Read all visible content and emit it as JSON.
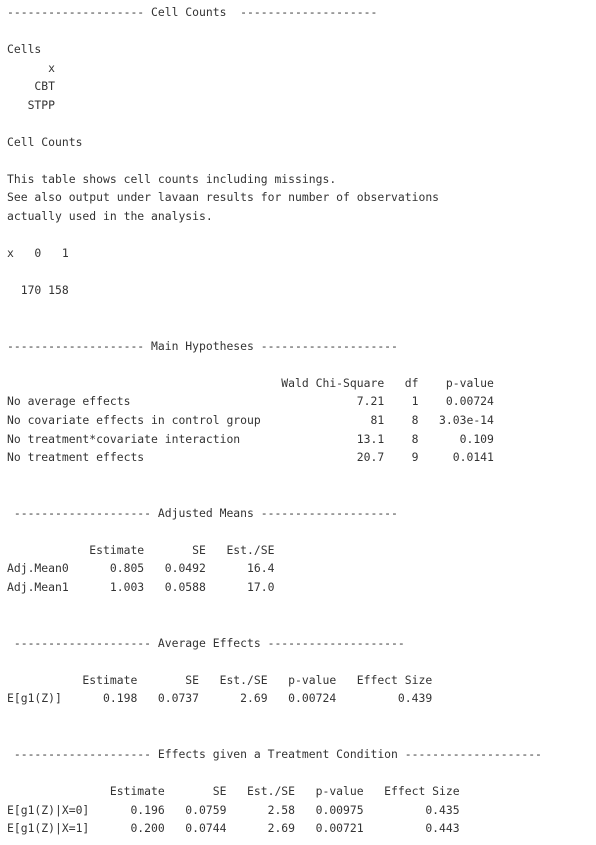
{
  "lines": [
    "-------------------- Cell Counts  --------------------",
    "",
    "Cells",
    "      x",
    "    CBT",
    "   STPP",
    "",
    "Cell Counts",
    "",
    "This table shows cell counts including missings.",
    "See also output under lavaan results for number of observations",
    "actually used in the analysis.",
    "",
    "x   0   1",
    "",
    "  170 158",
    "",
    "",
    "-------------------- Main Hypotheses --------------------",
    "",
    "                                        Wald Chi-Square   df    p-value",
    "No average effects                                 7.21    1    0.00724",
    "No covariate effects in control group                81    8   3.03e-14",
    "No treatment*covariate interaction                 13.1    8      0.109",
    "No treatment effects                               20.7    9     0.0141",
    "",
    "",
    " -------------------- Adjusted Means --------------------",
    "",
    "            Estimate       SE   Est./SE",
    "Adj.Mean0      0.805   0.0492      16.4",
    "Adj.Mean1      1.003   0.0588      17.0",
    "",
    "",
    " -------------------- Average Effects --------------------",
    "",
    "           Estimate       SE   Est./SE   p-value   Effect Size",
    "E[g1(Z)]      0.198   0.0737      2.69   0.00724         0.439",
    "",
    "",
    " -------------------- Effects given a Treatment Condition --------------------",
    "",
    "               Estimate       SE   Est./SE   p-value   Effect Size",
    "E[g1(Z)|X=0]      0.196   0.0759      2.58   0.00975         0.435",
    "E[g1(Z)|X=1]      0.200   0.0744      2.69   0.00721         0.443"
  ]
}
